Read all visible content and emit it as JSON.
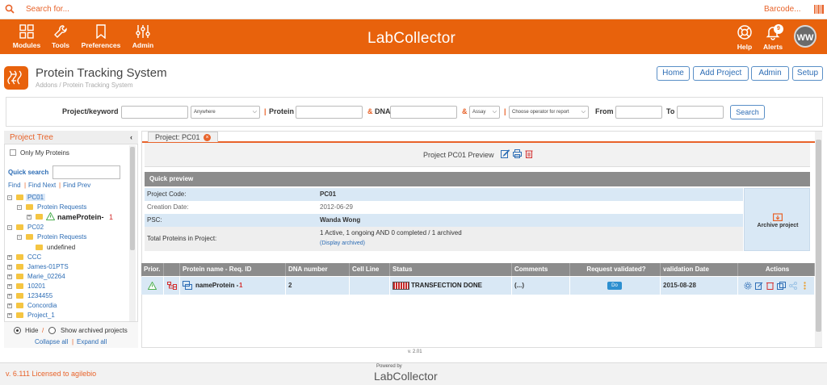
{
  "topbar": {
    "search_placeholder": "Search for...",
    "barcode_label": "Barcode..."
  },
  "nav": {
    "items": [
      "Modules",
      "Tools",
      "Preferences",
      "Admin"
    ],
    "logo": "LabCollector",
    "help_label": "Help",
    "alerts_label": "Alerts",
    "alerts_count": "9",
    "avatar_initials": "WW"
  },
  "page": {
    "title": "Protein Tracking System",
    "breadcrumb": "Addons / Protein Tracking System",
    "buttons": [
      "Home",
      "Add Project",
      "Admin",
      "Setup"
    ]
  },
  "form": {
    "project_label": "Project/keyword",
    "anywhere": "Anywhere",
    "protein_label": "Protein",
    "dna_label": "DNA",
    "assay": "Assay",
    "operator": "Choose operator for report",
    "from_label": "From",
    "to_label": "To",
    "search_label": "Search",
    "sep_bar": "|",
    "sep_amp": "&"
  },
  "tree": {
    "title": "Project Tree",
    "only_my": "Only My Proteins",
    "quick_search": "Quick search",
    "find": "Find",
    "find_next": "Find Next",
    "find_prev": "Find Prev",
    "nodes": {
      "pc01": "PC01",
      "pc01_req": "Protein Requests",
      "pc01_protein": "nameProtein-",
      "pc01_protein_num": "1",
      "pc02": "PC02",
      "pc02_req": "Protein Requests",
      "pc02_undef": "undefined",
      "ccc": "CCC",
      "james": "James-01PTS",
      "marie": "Marie_02264",
      "n10201": "10201",
      "n1234455": "1234455",
      "concordia": "Concordia",
      "project1": "Project_1"
    },
    "hide_label": "Hide",
    "show_archived": "Show archived projects",
    "collapse_all": "Collapse all",
    "expand_all": "Expand all"
  },
  "main": {
    "tab_label": "Project: PC01",
    "preview_title": "Project PC01 Preview",
    "quick_preview": "Quick preview",
    "project_code_k": "Project Code:",
    "project_code_v": "PC01",
    "creation_k": "Creation Date:",
    "creation_v": "2012-06-29",
    "psc_k": "PSC:",
    "psc_v": "Wanda Wong",
    "total_k": "Total Proteins in Project:",
    "total_v": "1 Active, 1 ongoing AND 0 completed / 1 archived",
    "display_archived": "(Display archived)",
    "archive_label": "Archive project",
    "table_headers": [
      "Prior.",
      "",
      "Protein name - Req. ID",
      "DNA number",
      "Cell Line",
      "Status",
      "Comments",
      "Request validated?",
      "validation Date",
      "Actions"
    ],
    "row": {
      "protein": "nameProtein -",
      "req_id": "1",
      "dna": "2",
      "cell": "",
      "status": "TRANSFECTION DONE",
      "comments": "(...)",
      "validated": "Do",
      "date": "2015-08-28"
    },
    "version": "v. 2.01"
  },
  "footer": {
    "license": "v. 6.111 Licensed to agilebio",
    "powered_by": "Powered by",
    "logo": "LabCollector"
  }
}
